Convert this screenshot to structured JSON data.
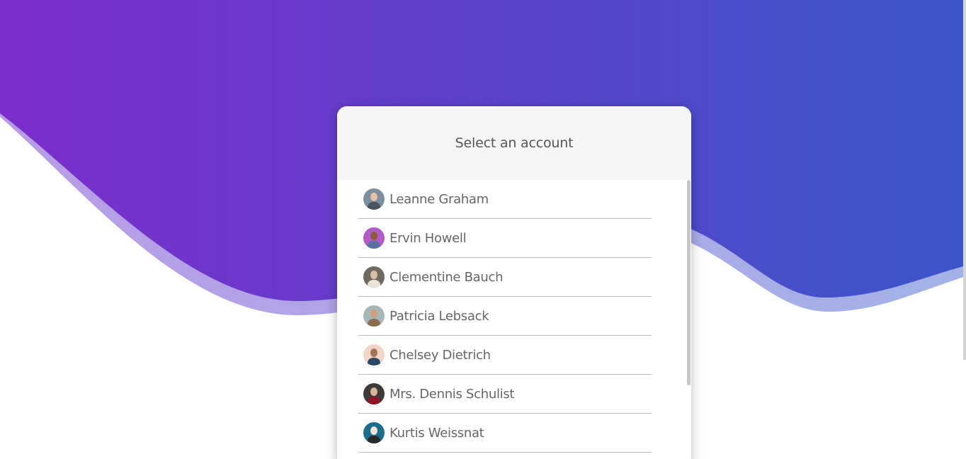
{
  "dialog": {
    "title": "Select an account"
  },
  "accounts": [
    {
      "name": "Leanne Graham",
      "avatar_icon": "user-avatar-icon",
      "bg": "#7d8f9e",
      "face": "#e6c3a8",
      "body": "#4a5560"
    },
    {
      "name": "Ervin Howell",
      "avatar_icon": "user-avatar-icon",
      "bg": "#b45bc9",
      "face": "#8a5a3c",
      "body": "#5a6d9c"
    },
    {
      "name": "Clementine Bauch",
      "avatar_icon": "user-avatar-icon",
      "bg": "#6e6a60",
      "face": "#d8c0a6",
      "body": "#e8e4dc"
    },
    {
      "name": "Patricia Lebsack",
      "avatar_icon": "user-avatar-icon",
      "bg": "#a9b6b8",
      "face": "#c9a27a",
      "body": "#8c6f52"
    },
    {
      "name": "Chelsey Dietrich",
      "avatar_icon": "user-avatar-icon",
      "bg": "#f2d7c9",
      "face": "#a47254",
      "body": "#2e4660"
    },
    {
      "name": "Mrs. Dennis Schulist",
      "avatar_icon": "user-avatar-icon",
      "bg": "#3d3a38",
      "face": "#d9b49a",
      "body": "#8b1525"
    },
    {
      "name": "Kurtis Weissnat",
      "avatar_icon": "user-avatar-icon",
      "bg": "#1b6e8c",
      "face": "#f0e6dc",
      "body": "#2a2a2a"
    }
  ],
  "colors": {
    "gradient_start": "#7b2dcb",
    "gradient_end": "#3c55c8",
    "wave_highlight_start": "#b89ce6",
    "wave_highlight_end": "#a3b1e6",
    "header_bg": "#f5f5f5"
  }
}
